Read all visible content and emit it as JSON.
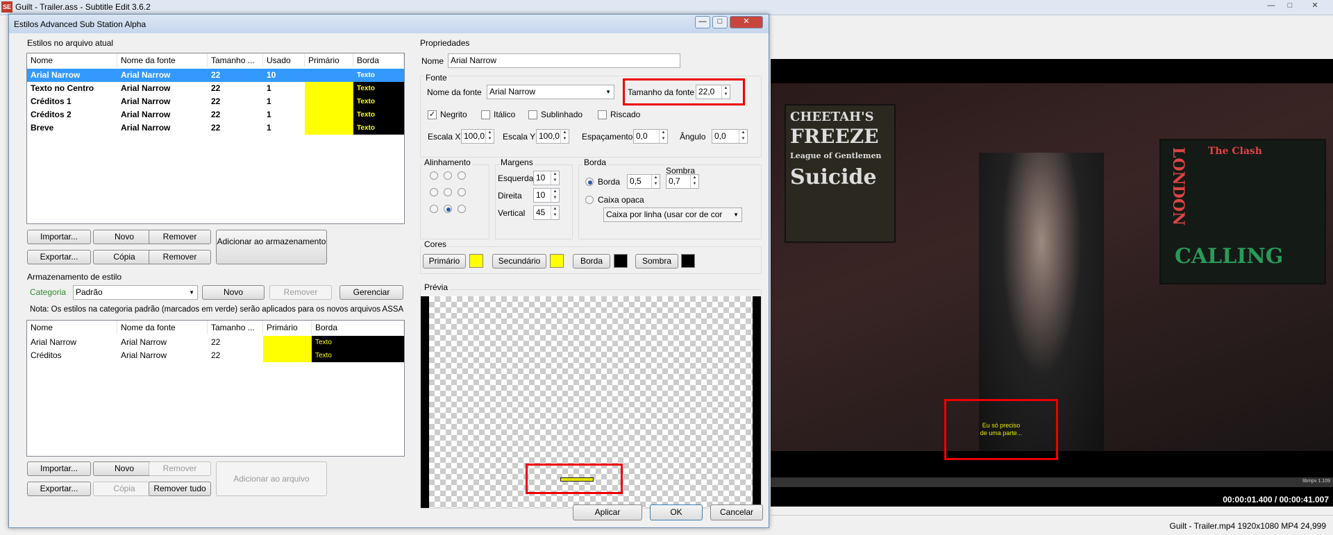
{
  "app": {
    "title": "Guilt - Trailer.ass - Subtitle Edit 3.6.2",
    "icon_text": "SE",
    "status": "Guilt - Trailer.mp4 1920x1080 MP4 24,999",
    "timecode": "00:00:01.400 / 00:00:41.007",
    "mpv_label": "libmpv 1.109",
    "video_subtitle": "Eu só preciso\nde uma parte...",
    "poster_texts": [
      "CHEETAH'S",
      "FREEZE",
      "League of Gentlemen",
      "Suicide",
      "The Clash",
      "LONDON",
      "CALLING"
    ]
  },
  "dialog": {
    "title": "Estilos Advanced Sub Station Alpha",
    "file_styles_label": "Estilos no arquivo atual",
    "file_table": {
      "headers": [
        "Nome",
        "Nome da fonte",
        "Tamanho ...",
        "Usado",
        "Primário",
        "Borda"
      ],
      "rows": [
        {
          "name": "Arial Narrow",
          "font": "Arial Narrow",
          "size": "22",
          "used": "10",
          "border": "Texto"
        },
        {
          "name": "Texto no Centro",
          "font": "Arial Narrow",
          "size": "22",
          "used": "1",
          "border": "Texto"
        },
        {
          "name": "Créditos 1",
          "font": "Arial Narrow",
          "size": "22",
          "used": "1",
          "border": "Texto"
        },
        {
          "name": "Créditos 2",
          "font": "Arial Narrow",
          "size": "22",
          "used": "1",
          "border": "Texto"
        },
        {
          "name": "Breve",
          "font": "Arial Narrow",
          "size": "22",
          "used": "1",
          "border": "Texto"
        }
      ]
    },
    "file_buttons": {
      "import": "Importar...",
      "new": "Novo",
      "remove": "Remover",
      "add_storage": "Adicionar ao armazenamento",
      "export": "Exportar...",
      "copy": "Cópia",
      "remove2": "Remover"
    },
    "storage": {
      "label": "Armazenamento de estilo",
      "category_label": "Categoria",
      "category_value": "Padrão",
      "new": "Novo",
      "remove": "Remover",
      "manage": "Gerenciar",
      "note": "Nota: Os estilos na categoria padrão (marcados em verde) serão aplicados para os novos arquivos ASSA",
      "headers": [
        "Nome",
        "Nome da fonte",
        "Tamanho ...",
        "Primário",
        "Borda"
      ],
      "rows": [
        {
          "name": "Arial Narrow",
          "font": "Arial Narrow",
          "size": "22",
          "border": "Texto"
        },
        {
          "name": "Créditos",
          "font": "Arial Narrow",
          "size": "22",
          "border": "Texto"
        }
      ],
      "buttons": {
        "import": "Importar...",
        "new": "Novo",
        "remove": "Remover",
        "add_file": "Adicionar ao arquivo",
        "export": "Exportar...",
        "copy": "Cópia",
        "remove_all": "Remover tudo"
      }
    },
    "props": {
      "label": "Propriedades",
      "name_label": "Nome",
      "name_value": "Arial Narrow",
      "font_group": "Fonte",
      "font_name_label": "Nome da fonte",
      "font_name_value": "Arial Narrow",
      "font_size_label": "Tamanho da fonte",
      "font_size_value": "22,0",
      "bold": "Negrito",
      "italic": "Itálico",
      "underline": "Sublinhado",
      "strike": "Riscado",
      "scale_x_label": "Escala X",
      "scale_x": "100,0",
      "scale_y_label": "Escala Y",
      "scale_y": "100,0",
      "spacing_label": "Espaçamento",
      "spacing": "0,0",
      "angle_label": "Ângulo",
      "angle": "0,0",
      "align_label": "Alinhamento",
      "margins_label": "Margens",
      "left_label": "Esquerda",
      "left": "10",
      "right_label": "Direita",
      "right": "10",
      "vertical_label": "Vertical",
      "vertical": "45",
      "border_label": "Borda",
      "shadow_label": "Sombra",
      "border_radio": "Borda",
      "border_value": "0,5",
      "shadow_value": "0,7",
      "opaque_box": "Caixa opaca",
      "box_type": "Caixa por linha (usar cor de cor",
      "colors_label": "Cores",
      "primary": "Primário",
      "secondary": "Secundário",
      "border_color": "Borda",
      "shadow_color": "Sombra",
      "preview_label": "Prévia",
      "colors": {
        "primary": "#ffff00",
        "secondary": "#ffff00",
        "border": "#000000",
        "shadow": "#000000"
      }
    },
    "footer": {
      "apply": "Aplicar",
      "ok": "OK",
      "cancel": "Cancelar"
    }
  },
  "colors": {
    "selection": "#3399ff",
    "highlight": "#e00000",
    "category": "#2e8b2e"
  }
}
